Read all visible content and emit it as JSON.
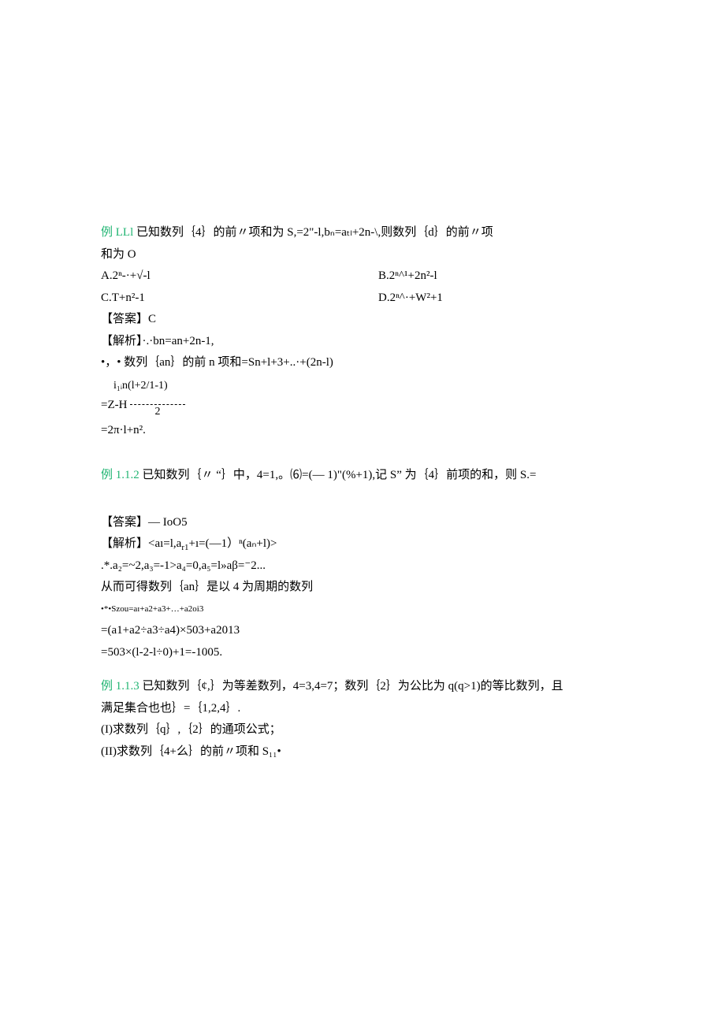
{
  "ex1": {
    "label": "例 LLl",
    "stem1": " 已知数列｛4｝的前〃项和为 S,=2\"‑l,bₙ=aₜₗ+2n‑\\,则数列｛d｝的前〃项",
    "stem2": "和为 O",
    "choiceA": "A.2ⁿ‑·+√‑l",
    "choiceB": "B.2ⁿ^¹+2n²‑l",
    "choiceC": "C.T+n²-1",
    "choiceD": "D.2ⁿ^·+W²+1",
    "ans": "【答案】C",
    "sol1": "【解析】·.·bn=an+2n-1,",
    "sol2": "•，• 数列｛an｝的前 n 项和=Sn+l+3+..·+(2n-l)",
    "sol3a": "=Z-H",
    "frac_num": "i₁ᵢn(l+2/1-1)",
    "frac_den": "2",
    "sol4": "=2π·l+n²."
  },
  "ex2": {
    "label": "例 1.1.2",
    "stem": " 已知数列｛〃 “｝中，4=1,。⑹=(— 1)\"(%+1),记 S” 为｛4｝前项的和，则 S.=",
    "ans": "【答案】— IoO5",
    "sol1": "【解析】<aı=l,a",
    "sol1b": "+ı=(—1）ⁿ(aₙ+l)>",
    "sol2": ".*.a₂=~2,a₃=-1>a₄=0,a₅=l»aβ=⁻2...",
    "sol3": "从而可得数列｛an｝是以 4 为周期的数列",
    "sol4": "•*•Szou=aɪ+a2+a3+…+a2oi3",
    "sol5": "=(a1+a2÷a3÷a4)×503+a2013",
    "sol6": "=503×(l-2-l÷0)+1=-1005."
  },
  "ex3": {
    "label": "例 1.1.3",
    "stem1": " 已知数列｛¢,｝为等差数列，4=3,4=7；数列｛2｝为公比为 q(q>1)的等比数列，且",
    "stem2": "满足集合也也｝=｛1,2,4｝.",
    "part1": "(I)求数列｛q｝,｛2｝的通项公式；",
    "part2": "(II)求数列｛4+么｝的前〃项和 S₁₁•"
  }
}
